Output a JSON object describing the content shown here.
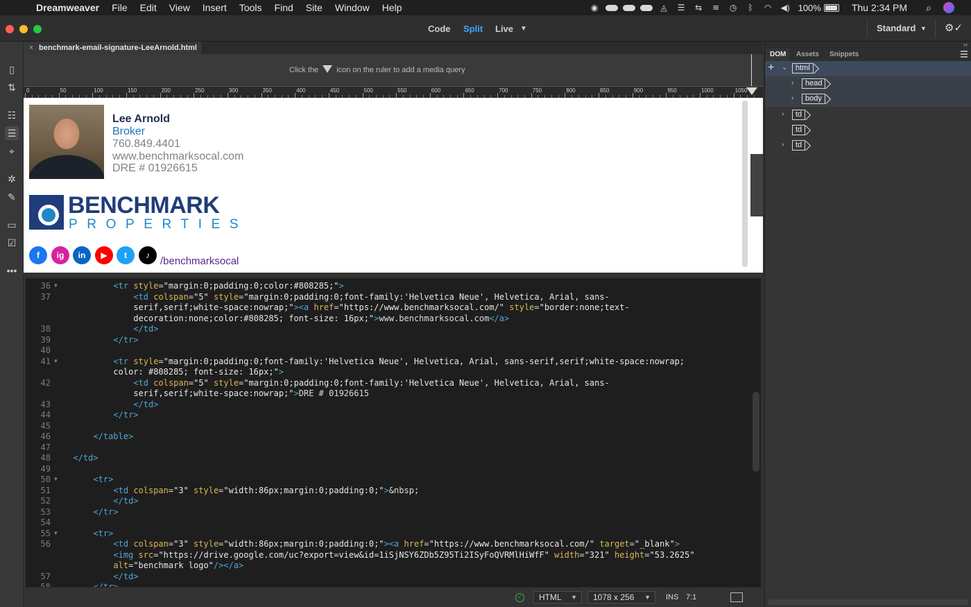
{
  "menubar": {
    "apple": "",
    "app": "Dreamweaver",
    "items": [
      "File",
      "Edit",
      "View",
      "Insert",
      "Tools",
      "Find",
      "Site",
      "Window",
      "Help"
    ],
    "battery": "100%",
    "clock": "Thu 2:34 PM"
  },
  "titlebar": {
    "views": [
      "Code",
      "Split",
      "Live"
    ],
    "active_view": "Split",
    "workspace": "Standard"
  },
  "document": {
    "tab_name": "benchmark-email-signature-LeeArnold.html"
  },
  "mediaquery": {
    "before": "Click the",
    "after": "icon on the ruler to add a media query"
  },
  "ruler": {
    "labels": [
      "0",
      "50",
      "100",
      "150",
      "200",
      "250",
      "300",
      "350",
      "400",
      "450",
      "500",
      "550",
      "600",
      "650",
      "700",
      "750",
      "800",
      "850",
      "900",
      "950",
      "1000",
      "1050"
    ]
  },
  "signature": {
    "name": "Lee Arnold",
    "title": "Broker",
    "phone": "760.849.4401",
    "website": "www.benchmarksocal.com",
    "license": "DRE # 01926615",
    "logo_word": "BENCHMARK",
    "logo_sub": "PROPERTIES",
    "social": [
      {
        "label": "f",
        "color": "#1877f2"
      },
      {
        "label": "ig",
        "color": "#d6249f"
      },
      {
        "label": "in",
        "color": "#0a66c2"
      },
      {
        "label": "▶",
        "color": "#ff0000"
      },
      {
        "label": "t",
        "color": "#1da1f2"
      },
      {
        "label": "♪",
        "color": "#000000"
      }
    ],
    "handle": "/benchmarksocal"
  },
  "code": {
    "lines": [
      {
        "n": "36",
        "f": true,
        "i": 10,
        "h": "<span class=\"tg\">&lt;tr</span> <span class=\"at\">style</span>=<span class=\"vl\">\"margin:0;padding:0;color:#808285;\"</span><span class=\"tg\">&gt;</span>"
      },
      {
        "n": "37",
        "f": false,
        "i": 14,
        "h": "<span class=\"tg\">&lt;td</span> <span class=\"at\">colspan</span>=<span class=\"vl\">\"5\"</span> <span class=\"at\">style</span>=<span class=\"vl\">\"margin:0;padding:0;font-family:'Helvetica Neue', Helvetica, Arial, sans-</span>"
      },
      {
        "n": "",
        "f": false,
        "i": 14,
        "h": "<span class=\"vl\">serif,serif;white-space:nowrap;\"</span><span class=\"tg\">&gt;&lt;a</span> <span class=\"at\">href</span>=<span class=\"vl\">\"https://www.benchmarksocal.com/\"</span> <span class=\"at\">style</span>=<span class=\"vl\">\"border:none;text-</span>"
      },
      {
        "n": "",
        "f": false,
        "i": 14,
        "h": "<span class=\"vl\">decoration:none;color:#808285; font-size: 16px;\"</span><span class=\"tg\">&gt;</span>www.benchmarksocal.com<span class=\"tg\">&lt;/a&gt;</span>"
      },
      {
        "n": "38",
        "f": false,
        "i": 14,
        "h": "<span class=\"tg\">&lt;/td&gt;</span>"
      },
      {
        "n": "39",
        "f": false,
        "i": 10,
        "h": "<span class=\"tg\">&lt;/tr&gt;</span>"
      },
      {
        "n": "40",
        "f": false,
        "i": 0,
        "h": ""
      },
      {
        "n": "41",
        "f": true,
        "i": 10,
        "h": "<span class=\"tg\">&lt;tr</span> <span class=\"at\">style</span>=<span class=\"vl\">\"margin:0;padding:0;font-family:'Helvetica Neue', Helvetica, Arial, sans-serif,serif;white-space:nowrap;</span>"
      },
      {
        "n": "",
        "f": false,
        "i": 10,
        "h": "<span class=\"vl\">color: #808285; font-size: 16px;\"</span><span class=\"tg\">&gt;</span>"
      },
      {
        "n": "42",
        "f": false,
        "i": 14,
        "h": "<span class=\"tg\">&lt;td</span> <span class=\"at\">colspan</span>=<span class=\"vl\">\"5\"</span> <span class=\"at\">style</span>=<span class=\"vl\">\"margin:0;padding:0;font-family:'Helvetica Neue', Helvetica, Arial, sans-</span>"
      },
      {
        "n": "",
        "f": false,
        "i": 14,
        "h": "<span class=\"vl\">serif,serif;white-space:nowrap;\"</span><span class=\"tg\">&gt;</span>DRE # 01926615"
      },
      {
        "n": "43",
        "f": false,
        "i": 14,
        "h": "<span class=\"tg\">&lt;/td&gt;</span>"
      },
      {
        "n": "44",
        "f": false,
        "i": 10,
        "h": "<span class=\"tg\">&lt;/tr&gt;</span>"
      },
      {
        "n": "45",
        "f": false,
        "i": 0,
        "h": ""
      },
      {
        "n": "46",
        "f": false,
        "i": 6,
        "h": "<span class=\"tg\">&lt;/table&gt;</span>"
      },
      {
        "n": "47",
        "f": false,
        "i": 0,
        "h": ""
      },
      {
        "n": "48",
        "f": false,
        "i": 2,
        "h": "<span class=\"tg\">&lt;/td&gt;</span>"
      },
      {
        "n": "49",
        "f": false,
        "i": 0,
        "h": ""
      },
      {
        "n": "50",
        "f": true,
        "i": 6,
        "h": "<span class=\"tg\">&lt;tr&gt;</span>"
      },
      {
        "n": "51",
        "f": false,
        "i": 10,
        "h": "<span class=\"tg\">&lt;td</span> <span class=\"at\">colspan</span>=<span class=\"vl\">\"3\"</span> <span class=\"at\">style</span>=<span class=\"vl\">\"width:86px;margin:0;padding:0;\"</span><span class=\"tg\">&gt;</span>&amp;nbsp;"
      },
      {
        "n": "52",
        "f": false,
        "i": 10,
        "h": "<span class=\"tg\">&lt;/td&gt;</span>"
      },
      {
        "n": "53",
        "f": false,
        "i": 6,
        "h": "<span class=\"tg\">&lt;/tr&gt;</span>"
      },
      {
        "n": "54",
        "f": false,
        "i": 0,
        "h": ""
      },
      {
        "n": "55",
        "f": true,
        "i": 6,
        "h": "<span class=\"tg\">&lt;tr&gt;</span>"
      },
      {
        "n": "56",
        "f": false,
        "i": 10,
        "h": "<span class=\"tg\">&lt;td</span> <span class=\"at\">colspan</span>=<span class=\"vl\">\"3\"</span> <span class=\"at\">style</span>=<span class=\"vl\">\"width:86px;margin:0;padding:0;\"</span><span class=\"tg\">&gt;&lt;a</span> <span class=\"at\">href</span>=<span class=\"vl\">\"https://www.benchmarksocal.com/\"</span> <span class=\"at\">target</span>=<span class=\"vl\">\"_blank\"</span><span class=\"tg\">&gt;</span>"
      },
      {
        "n": "",
        "f": false,
        "i": 10,
        "h": "<span class=\"tg\">&lt;img</span> <span class=\"at\">src</span>=<span class=\"vl\">\"https://drive.google.com/uc?export=view&amp;id=1iSjNSY6ZDb5Z95Ti2ISyFoQVRMlHiWfF\"</span> <span class=\"at\">width</span>=<span class=\"vl\">\"321\"</span> <span class=\"at\">height</span>=<span class=\"vl\">\"53.2625\"</span>"
      },
      {
        "n": "",
        "f": false,
        "i": 10,
        "h": "<span class=\"at\">alt</span>=<span class=\"vl\">\"benchmark logo\"</span><span class=\"tg\">/&gt;&lt;/a&gt;</span>"
      },
      {
        "n": "57",
        "f": false,
        "i": 10,
        "h": "<span class=\"tg\">&lt;/td&gt;</span>"
      },
      {
        "n": "58",
        "f": false,
        "i": 6,
        "h": "<span class=\"tg\">&lt;/tr&gt;</span>"
      }
    ]
  },
  "statusbar": {
    "language": "HTML",
    "size": "1078 x 256",
    "mode": "INS",
    "position": "7:1"
  },
  "panel": {
    "tabs": [
      "DOM",
      "Assets",
      "Snippets"
    ],
    "active_tab": "DOM",
    "nodes": [
      {
        "tag": "html",
        "expanded": true
      },
      {
        "tag": "head",
        "expanded": false
      },
      {
        "tag": "body",
        "expanded": false
      },
      {
        "tag": "td",
        "expanded": false
      },
      {
        "tag": "td",
        "expanded": null
      },
      {
        "tag": "td",
        "expanded": false
      }
    ]
  }
}
